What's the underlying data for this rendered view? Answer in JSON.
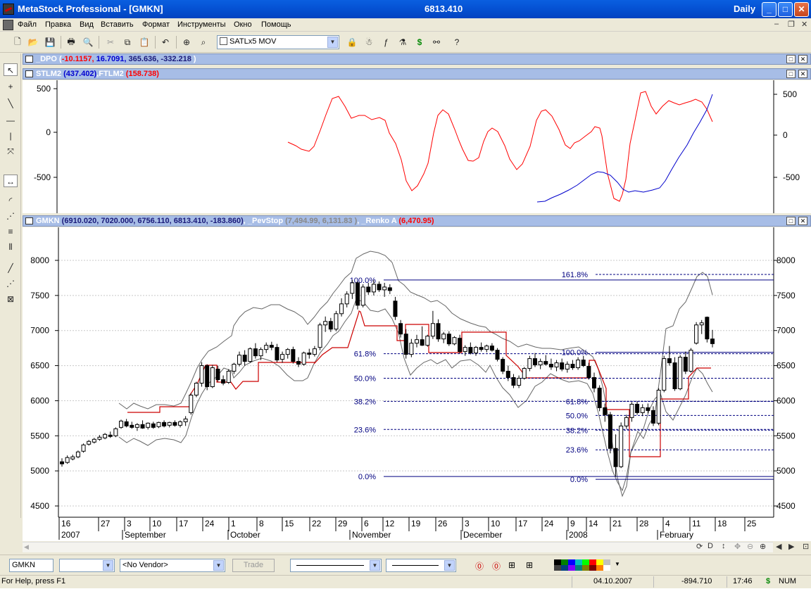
{
  "window": {
    "title": "MetaStock Professional - [GMKN]",
    "price": "6813.410",
    "periodicity": "Daily",
    "minimize": "_",
    "maximize": "□",
    "close": "✕"
  },
  "menu": {
    "items": [
      "Файл",
      "Правка",
      "Вид",
      "Вставить",
      "Формат",
      "Инструменты",
      "Окно",
      "Помощь"
    ]
  },
  "toolbar": {
    "expert_combo": "SATLx5 MOV"
  },
  "panes": {
    "dpo": {
      "name": "_DPO",
      "open": "(",
      "v1": "-10.1157,",
      "v2": "16.7091,",
      "v3": "365.636,",
      "v4": "-332.218",
      "close": ")"
    },
    "stlm": {
      "name1": "STLM2",
      "v1": "(437.402)",
      "sep": ",",
      "name2": "FTLM2",
      "v2": "(158.738)"
    },
    "gmkn": {
      "name": "GMKN",
      "values": "(6910.020, 7020.000, 6756.110, 6813.410, -183.860)",
      "sep1": ",",
      "pev_name": "_PevStop",
      "pev_values": "(7,494.99, 6,131.83 )",
      "sep2": ",",
      "renko_name": "_Renko A",
      "renko_value": "(6,470.95)"
    }
  },
  "indicator_axis": {
    "ticks_left": [
      "500",
      "0",
      "-500"
    ],
    "ticks_right": [
      "500",
      "0",
      "-500"
    ]
  },
  "price_axis": {
    "ticks": [
      "8000",
      "7500",
      "7000",
      "6500",
      "6000",
      "5500",
      "5000",
      "4500"
    ]
  },
  "time_axis": {
    "days": [
      "16",
      "27",
      "3",
      "10",
      "17",
      "24",
      "1",
      "8",
      "15",
      "22",
      "29",
      "6",
      "12",
      "19",
      "26",
      "3",
      "10",
      "17",
      "24",
      "9",
      "14",
      "21",
      "28",
      "4",
      "11",
      "18",
      "25"
    ],
    "labels": [
      "2007",
      "September",
      "October",
      "November",
      "December",
      "2008",
      "February"
    ]
  },
  "fib1": {
    "labels": [
      "100.0%",
      "61.8%",
      "50.0%",
      "38.2%",
      "23.6%",
      "0.0%"
    ]
  },
  "fib2": {
    "labels": [
      "161.8%",
      "100.0%",
      "61.8%",
      "50.0%",
      "38.2%",
      "23.6%",
      "0.0%"
    ]
  },
  "chart_data": {
    "type": "candlestick",
    "symbol": "GMKN",
    "ylim": [
      4500,
      8300
    ],
    "fib_levels_1": [
      7720,
      6670,
      6320,
      5990,
      5590,
      4920
    ],
    "fib_levels_2": [
      7800,
      6690,
      5990,
      5790,
      5580,
      5300,
      4880
    ],
    "candles": [
      {
        "o": 5130,
        "h": 5180,
        "l": 5060,
        "c": 5100
      },
      {
        "o": 5120,
        "h": 5220,
        "l": 5100,
        "c": 5190
      },
      {
        "o": 5170,
        "h": 5230,
        "l": 5150,
        "c": 5200
      },
      {
        "o": 5200,
        "h": 5290,
        "l": 5180,
        "c": 5270
      },
      {
        "o": 5280,
        "h": 5390,
        "l": 5260,
        "c": 5370
      },
      {
        "o": 5380,
        "h": 5440,
        "l": 5360,
        "c": 5420
      },
      {
        "o": 5410,
        "h": 5470,
        "l": 5390,
        "c": 5450
      },
      {
        "o": 5450,
        "h": 5510,
        "l": 5430,
        "c": 5480
      },
      {
        "o": 5470,
        "h": 5540,
        "l": 5450,
        "c": 5520
      },
      {
        "o": 5510,
        "h": 5560,
        "l": 5470,
        "c": 5490
      },
      {
        "o": 5500,
        "h": 5620,
        "l": 5480,
        "c": 5600
      },
      {
        "o": 5620,
        "h": 5730,
        "l": 5600,
        "c": 5710
      },
      {
        "o": 5700,
        "h": 5740,
        "l": 5620,
        "c": 5640
      },
      {
        "o": 5650,
        "h": 5700,
        "l": 5600,
        "c": 5620
      },
      {
        "o": 5620,
        "h": 5680,
        "l": 5570,
        "c": 5660
      },
      {
        "o": 5660,
        "h": 5720,
        "l": 5600,
        "c": 5610
      },
      {
        "o": 5620,
        "h": 5690,
        "l": 5590,
        "c": 5680
      },
      {
        "o": 5670,
        "h": 5700,
        "l": 5600,
        "c": 5620
      },
      {
        "o": 5630,
        "h": 5700,
        "l": 5610,
        "c": 5690
      },
      {
        "o": 5690,
        "h": 5720,
        "l": 5620,
        "c": 5640
      },
      {
        "o": 5650,
        "h": 5700,
        "l": 5620,
        "c": 5690
      },
      {
        "o": 5690,
        "h": 5720,
        "l": 5630,
        "c": 5650
      },
      {
        "o": 5650,
        "h": 5720,
        "l": 5620,
        "c": 5700
      },
      {
        "o": 5700,
        "h": 5780,
        "l": 5640,
        "c": 5740
      },
      {
        "o": 5830,
        "h": 6110,
        "l": 5800,
        "c": 6080
      },
      {
        "o": 6080,
        "h": 6270,
        "l": 6050,
        "c": 6250
      },
      {
        "o": 6250,
        "h": 6550,
        "l": 6200,
        "c": 6500
      },
      {
        "o": 6500,
        "h": 6520,
        "l": 6150,
        "c": 6200
      },
      {
        "o": 6200,
        "h": 6510,
        "l": 6180,
        "c": 6470
      },
      {
        "o": 6450,
        "h": 6500,
        "l": 6270,
        "c": 6300
      },
      {
        "o": 6300,
        "h": 6360,
        "l": 6220,
        "c": 6250
      },
      {
        "o": 6260,
        "h": 6450,
        "l": 6240,
        "c": 6420
      },
      {
        "o": 6420,
        "h": 6540,
        "l": 6380,
        "c": 6520
      },
      {
        "o": 6520,
        "h": 6700,
        "l": 6490,
        "c": 6650
      },
      {
        "o": 6650,
        "h": 6720,
        "l": 6500,
        "c": 6560
      },
      {
        "o": 6560,
        "h": 6760,
        "l": 6540,
        "c": 6740
      },
      {
        "o": 6740,
        "h": 6820,
        "l": 6600,
        "c": 6640
      },
      {
        "o": 6640,
        "h": 6760,
        "l": 6580,
        "c": 6730
      },
      {
        "o": 6730,
        "h": 6830,
        "l": 6680,
        "c": 6790
      },
      {
        "o": 6790,
        "h": 6840,
        "l": 6720,
        "c": 6760
      },
      {
        "o": 6760,
        "h": 6810,
        "l": 6550,
        "c": 6580
      },
      {
        "o": 6590,
        "h": 6700,
        "l": 6540,
        "c": 6660
      },
      {
        "o": 6660,
        "h": 6750,
        "l": 6600,
        "c": 6730
      },
      {
        "o": 6730,
        "h": 6770,
        "l": 6530,
        "c": 6560
      },
      {
        "o": 6560,
        "h": 6620,
        "l": 6480,
        "c": 6520
      },
      {
        "o": 6520,
        "h": 6700,
        "l": 6500,
        "c": 6680
      },
      {
        "o": 6680,
        "h": 6740,
        "l": 6600,
        "c": 6660
      },
      {
        "o": 6660,
        "h": 6780,
        "l": 6630,
        "c": 6740
      },
      {
        "o": 6760,
        "h": 7110,
        "l": 6720,
        "c": 7080
      },
      {
        "o": 7080,
        "h": 7200,
        "l": 6980,
        "c": 7130
      },
      {
        "o": 7130,
        "h": 7180,
        "l": 6980,
        "c": 7020
      },
      {
        "o": 7020,
        "h": 7280,
        "l": 6990,
        "c": 7240
      },
      {
        "o": 7240,
        "h": 7460,
        "l": 7200,
        "c": 7380
      },
      {
        "o": 7380,
        "h": 7560,
        "l": 7330,
        "c": 7520
      },
      {
        "o": 7530,
        "h": 7720,
        "l": 7450,
        "c": 7680
      },
      {
        "o": 7680,
        "h": 7700,
        "l": 7300,
        "c": 7360
      },
      {
        "o": 7360,
        "h": 7660,
        "l": 7330,
        "c": 7620
      },
      {
        "o": 7620,
        "h": 7680,
        "l": 7510,
        "c": 7550
      },
      {
        "o": 7550,
        "h": 7720,
        "l": 7500,
        "c": 7660
      },
      {
        "o": 7660,
        "h": 7700,
        "l": 7550,
        "c": 7580
      },
      {
        "o": 7580,
        "h": 7680,
        "l": 7480,
        "c": 7620
      },
      {
        "o": 7610,
        "h": 7660,
        "l": 7520,
        "c": 7570
      },
      {
        "o": 7420,
        "h": 7480,
        "l": 7150,
        "c": 7200
      },
      {
        "o": 7100,
        "h": 7150,
        "l": 6900,
        "c": 6950
      },
      {
        "o": 6950,
        "h": 7020,
        "l": 6600,
        "c": 6660
      },
      {
        "o": 6660,
        "h": 6880,
        "l": 6620,
        "c": 6820
      },
      {
        "o": 6820,
        "h": 6940,
        "l": 6760,
        "c": 6870
      },
      {
        "o": 6870,
        "h": 7060,
        "l": 6780,
        "c": 6790
      },
      {
        "o": 6790,
        "h": 6940,
        "l": 6770,
        "c": 6920
      },
      {
        "o": 6920,
        "h": 7280,
        "l": 6880,
        "c": 7100
      },
      {
        "o": 7100,
        "h": 7160,
        "l": 6840,
        "c": 6880
      },
      {
        "o": 6880,
        "h": 6980,
        "l": 6820,
        "c": 6950
      },
      {
        "o": 6950,
        "h": 6990,
        "l": 6780,
        "c": 6810
      },
      {
        "o": 6810,
        "h": 6920,
        "l": 6790,
        "c": 6900
      },
      {
        "o": 6890,
        "h": 6940,
        "l": 6670,
        "c": 6700
      },
      {
        "o": 6700,
        "h": 6790,
        "l": 6640,
        "c": 6760
      },
      {
        "o": 6760,
        "h": 6830,
        "l": 6660,
        "c": 6680
      },
      {
        "o": 6680,
        "h": 6780,
        "l": 6640,
        "c": 6760
      },
      {
        "o": 6760,
        "h": 6830,
        "l": 6700,
        "c": 6730
      },
      {
        "o": 6730,
        "h": 6800,
        "l": 6690,
        "c": 6780
      },
      {
        "o": 6780,
        "h": 6820,
        "l": 6700,
        "c": 6720
      },
      {
        "o": 6720,
        "h": 6750,
        "l": 6560,
        "c": 6590
      },
      {
        "o": 6590,
        "h": 6620,
        "l": 6380,
        "c": 6420
      },
      {
        "o": 6420,
        "h": 6500,
        "l": 6280,
        "c": 6330
      },
      {
        "o": 6330,
        "h": 6380,
        "l": 6180,
        "c": 6220
      },
      {
        "o": 6220,
        "h": 6360,
        "l": 6180,
        "c": 6320
      },
      {
        "o": 6320,
        "h": 6480,
        "l": 6300,
        "c": 6460
      },
      {
        "o": 6460,
        "h": 6640,
        "l": 6420,
        "c": 6600
      },
      {
        "o": 6600,
        "h": 6680,
        "l": 6480,
        "c": 6510
      },
      {
        "o": 6510,
        "h": 6600,
        "l": 6450,
        "c": 6560
      },
      {
        "o": 6560,
        "h": 6650,
        "l": 6500,
        "c": 6520
      },
      {
        "o": 6520,
        "h": 6600,
        "l": 6440,
        "c": 6480
      },
      {
        "o": 6480,
        "h": 6580,
        "l": 6420,
        "c": 6540
      },
      {
        "o": 6540,
        "h": 6600,
        "l": 6420,
        "c": 6450
      },
      {
        "o": 6450,
        "h": 6560,
        "l": 6400,
        "c": 6520
      },
      {
        "o": 6520,
        "h": 6580,
        "l": 6440,
        "c": 6470
      },
      {
        "o": 6470,
        "h": 6620,
        "l": 6440,
        "c": 6580
      },
      {
        "o": 6580,
        "h": 6640,
        "l": 6480,
        "c": 6500
      },
      {
        "o": 6490,
        "h": 6540,
        "l": 6300,
        "c": 6330
      },
      {
        "o": 6330,
        "h": 6400,
        "l": 6120,
        "c": 6180
      },
      {
        "o": 6180,
        "h": 6220,
        "l": 5850,
        "c": 5900
      },
      {
        "o": 5900,
        "h": 5960,
        "l": 5700,
        "c": 5800
      },
      {
        "o": 5800,
        "h": 5840,
        "l": 5250,
        "c": 5320
      },
      {
        "o": 5320,
        "h": 5520,
        "l": 4920,
        "c": 5060
      },
      {
        "o": 5060,
        "h": 5690,
        "l": 5040,
        "c": 5640
      },
      {
        "o": 5640,
        "h": 5800,
        "l": 5600,
        "c": 5760
      },
      {
        "o": 5760,
        "h": 5980,
        "l": 5700,
        "c": 5950
      },
      {
        "o": 5950,
        "h": 5990,
        "l": 5800,
        "c": 5830
      },
      {
        "o": 5830,
        "h": 5950,
        "l": 5780,
        "c": 5900
      },
      {
        "o": 5900,
        "h": 5960,
        "l": 5820,
        "c": 5860
      },
      {
        "o": 5860,
        "h": 5920,
        "l": 5640,
        "c": 5680
      },
      {
        "o": 5680,
        "h": 6180,
        "l": 5650,
        "c": 6150
      },
      {
        "o": 6150,
        "h": 6640,
        "l": 6120,
        "c": 6600
      },
      {
        "o": 6600,
        "h": 6780,
        "l": 6500,
        "c": 6540
      },
      {
        "o": 6540,
        "h": 6620,
        "l": 6140,
        "c": 6170
      },
      {
        "o": 6170,
        "h": 6650,
        "l": 6150,
        "c": 6620
      },
      {
        "o": 6620,
        "h": 6700,
        "l": 6380,
        "c": 6420
      },
      {
        "o": 6420,
        "h": 6750,
        "l": 6400,
        "c": 6720
      },
      {
        "o": 6820,
        "h": 7120,
        "l": 6800,
        "c": 7080
      },
      {
        "o": 7080,
        "h": 7150,
        "l": 6950,
        "c": 7110
      },
      {
        "o": 7190,
        "h": 7200,
        "l": 6830,
        "c": 6880
      },
      {
        "o": 6880,
        "h": 7010,
        "l": 6760,
        "c": 6813
      }
    ]
  }
}
